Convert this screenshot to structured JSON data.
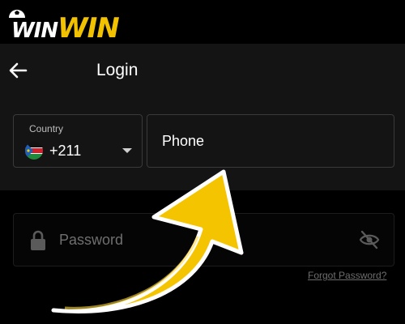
{
  "brand": {
    "logo_text_1": "WIN",
    "logo_text_2": "WIN",
    "accent": "#f2c200"
  },
  "header": {
    "title": "Login",
    "back_icon": "back-arrow-icon"
  },
  "country": {
    "label": "Country",
    "code": "+211",
    "flag": "south-sudan-flag-icon"
  },
  "phone": {
    "placeholder": "Phone"
  },
  "password": {
    "placeholder": "Password",
    "lock_icon": "lock-icon",
    "toggle_icon": "eye-off-icon"
  },
  "links": {
    "forgot": "Forgot Password?"
  },
  "overlay": {
    "arrow_color": "#f5c400",
    "icon": "curved-pointer-arrow-icon"
  }
}
